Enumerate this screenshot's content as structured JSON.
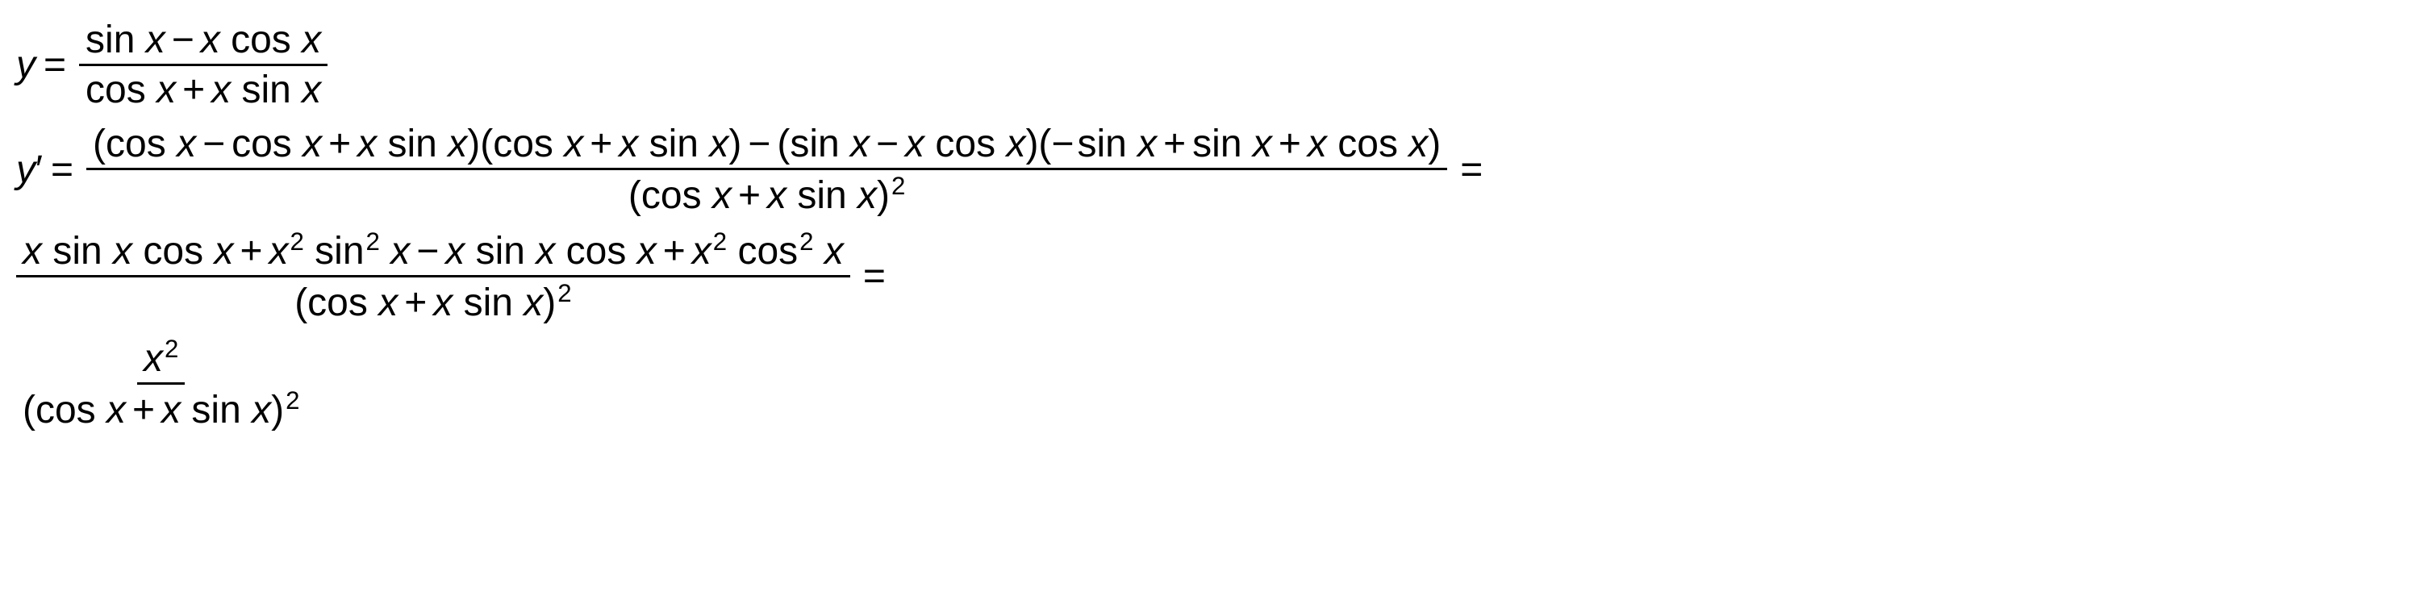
{
  "vars": {
    "y": "y",
    "x": "x"
  },
  "fn": {
    "sin": "sin",
    "cos": "cos"
  },
  "sym": {
    "eq": "=",
    "minus": "−",
    "plus": "+",
    "prime": "′",
    "lparen": "(",
    "rparen": ")",
    "two": "2"
  },
  "chart_data": {
    "type": "table",
    "title": "Derivative computation using quotient rule",
    "expressions": [
      "y = (sin x − x cos x) / (cos x + x sin x)",
      "y' = [(cos x − cos x + x sin x)(cos x + x sin x) − (sin x − x cos x)(−sin x + sin x + x cos x)] / (cos x + x sin x)^2 =",
      "(x sin x cos x + x^2 sin^2 x − x sin x cos x + x^2 cos^2 x) / (cos x + x sin x)^2 =",
      "x^2 / (cos x + x sin x)^2"
    ]
  }
}
